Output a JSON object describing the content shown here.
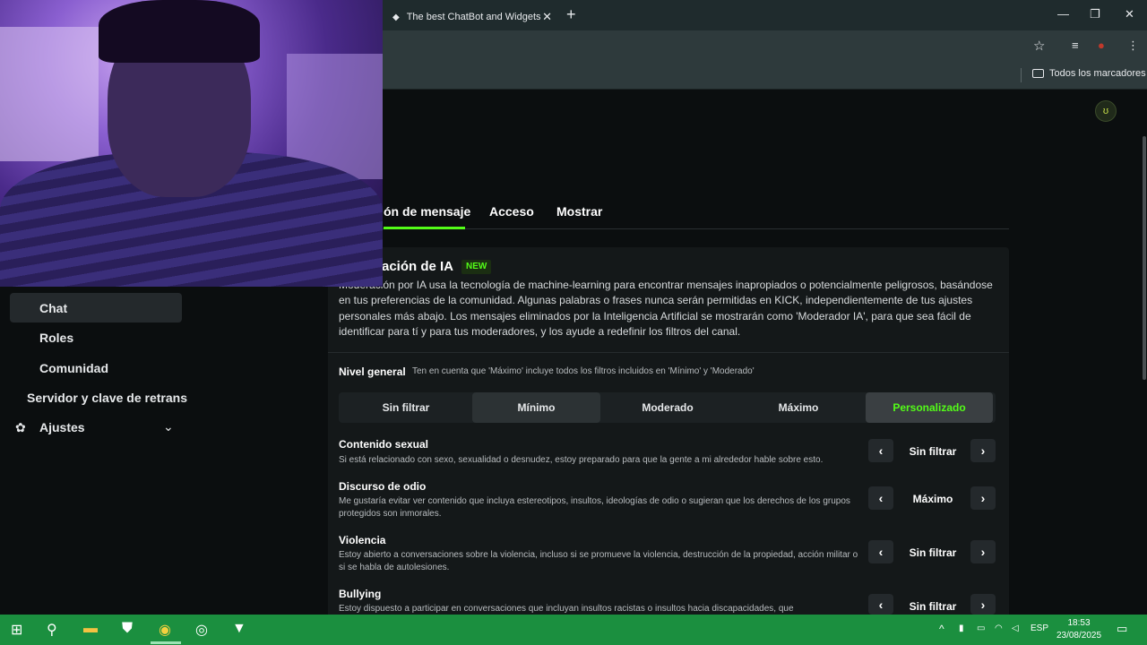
{
  "browser": {
    "tab_title": "The best ChatBot and Widgets",
    "tab_favicon": "◆",
    "tab_close": "✕",
    "new_tab": "+",
    "bookmarks_folder": "Todos los marcadores",
    "window_controls": {
      "minimize": "—",
      "maximize": "❐",
      "close": "✕"
    },
    "address_icons": {
      "star": "☆",
      "media": "≡",
      "profile": "●",
      "menu": "⋮"
    }
  },
  "header": {
    "avatar_icon": "ʊ"
  },
  "sidebar": {
    "items": [
      {
        "label": "Chat"
      },
      {
        "label": "Roles"
      },
      {
        "label": "Comunidad"
      },
      {
        "label": "Servidor y clave de retrans"
      },
      {
        "label": "Ajustes"
      }
    ],
    "gear_icon": "✿",
    "chevron_icon": "⌄"
  },
  "page_tabs": [
    {
      "label": "ón de mensaje",
      "active": true
    },
    {
      "label": "Acceso"
    },
    {
      "label": "Mostrar"
    }
  ],
  "section": {
    "title": "ación de IA",
    "badge": "NEW",
    "description": "Moderación por IA usa la tecnología de machine-learning para encontrar mensajes inapropiados o potencialmente peligrosos, basándose en tus preferencias de la comunidad. Algunas palabras o frases nunca serán permitidas en KICK, independientemente de tus ajustes personales más abajo. Los mensajes eliminados por la Inteligencia Artificial se mostrarán como 'Moderador IA', para que sea fácil de identificar para tí y para tus moderadores, y los ayude a redefinir los filtros del canal."
  },
  "nivel": {
    "label": "Nivel general",
    "hint": "Ten en cuenta que 'Máximo' incluye todos los filtros incluidos en 'Mínimo' y 'Moderado'",
    "options": [
      "Sin filtrar",
      "Mínimo",
      "Moderado",
      "Máximo",
      "Personalizado"
    ],
    "selected": "Personalizado"
  },
  "filters": [
    {
      "title": "Contenido sexual",
      "desc": "Si está relacionado con sexo, sexualidad o desnudez, estoy preparado para que la gente a mi alrededor hable sobre esto.",
      "value": "Sin filtrar"
    },
    {
      "title": "Discurso de odio",
      "desc": "Me gustaría evitar ver contenido que incluya estereotipos, insultos, ideologías de odio o sugieran que los derechos de los grupos protegidos son inmorales.",
      "value": "Máximo"
    },
    {
      "title": "Violencia",
      "desc": "Estoy abierto a conversaciones sobre la violencia, incluso si se promueve la violencia, destrucción de la propiedad, acción militar o si se habla de autolesiones.",
      "value": "Sin filtrar"
    },
    {
      "title": "Bullying",
      "desc": "Estoy dispuesto a participar en conversaciones que incluyan insultos racistas o insultos hacia discapacidades, que",
      "value": "Sin filtrar"
    }
  ],
  "arrows": {
    "prev": "‹",
    "next": "›"
  },
  "taskbar": {
    "start_icon": "⊞",
    "search_icon": "⚲",
    "explorer_icon": "▬",
    "defender_icon": "⛊",
    "chrome_icon": "◉",
    "obs_icon": "◎",
    "app_icon": "▼",
    "lang": "ESP",
    "time": "18:53",
    "date": "23/08/2025",
    "tray_up": "^",
    "notif_icon": "▭"
  }
}
